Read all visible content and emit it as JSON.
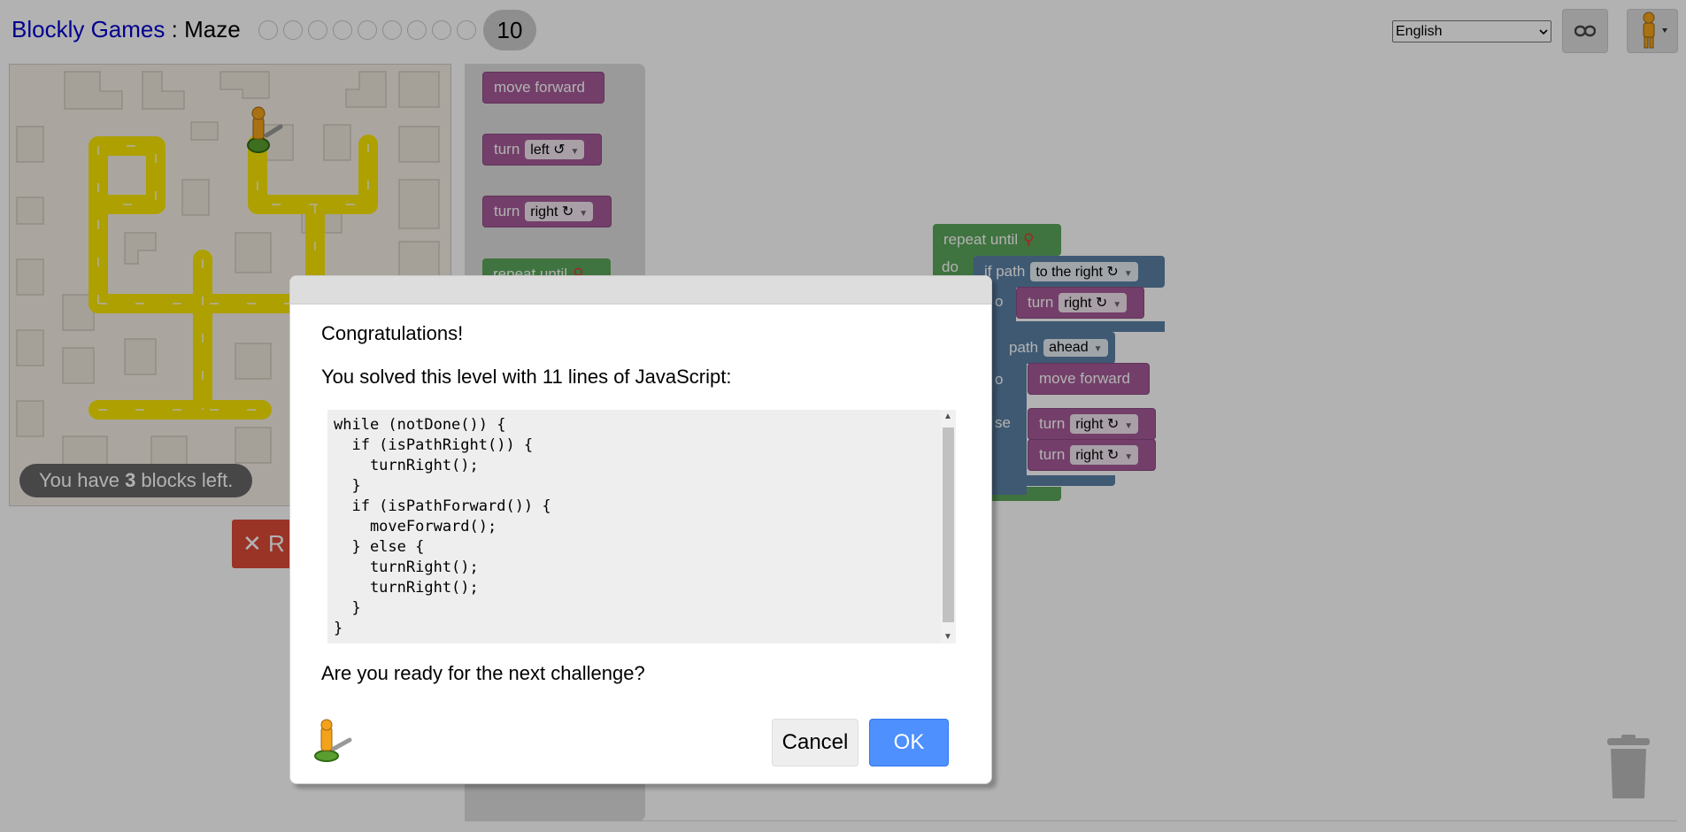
{
  "header": {
    "app_link": "Blockly Games",
    "separator": ":",
    "game_name": "Maze",
    "level_count": 9,
    "current_level": "10",
    "language": "English"
  },
  "maze": {
    "capacity_prefix": "You have ",
    "capacity_count": "3",
    "capacity_suffix": " blocks left.",
    "reset_label": "R"
  },
  "toolbox": {
    "move_forward": "move forward",
    "turn": "turn",
    "left": "left ↺",
    "right": "right ↻",
    "repeat_until": "repeat until"
  },
  "program": {
    "repeat_until": "repeat until",
    "do": "do",
    "if_path": "if path",
    "to_the_right": "to the right ↻",
    "do_short": "o",
    "turn": "turn",
    "right": "right ↻",
    "path": "path",
    "ahead": "ahead",
    "move_forward": "move forward",
    "else": "se"
  },
  "dialog": {
    "congrats": "Congratulations!",
    "solved": "You solved this level with 11 lines of JavaScript:",
    "code_lines": [
      "while (notDone()) {",
      "  if (isPathRight()) {",
      "    turnRight();",
      "  }",
      "  if (isPathForward()) {",
      "    moveForward();",
      "  } else {",
      "    turnRight();",
      "    turnRight();",
      "  }",
      "}"
    ],
    "question": "Are you ready for the next challenge?",
    "cancel_label": "Cancel",
    "ok_label": "OK"
  },
  "colors": {
    "motion_block": "#a55b99",
    "loop_block": "#5ba55b",
    "logic_block": "#5b80a5",
    "ok_button": "#4d90fe",
    "path": "#f8e600"
  }
}
